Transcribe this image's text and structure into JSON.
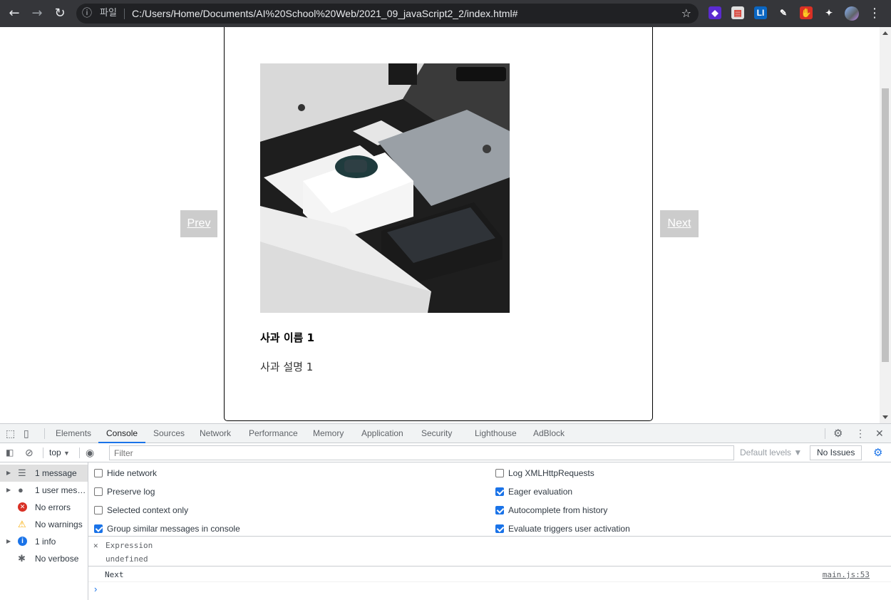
{
  "browser": {
    "back": "←",
    "forward": "→",
    "reload": "↻",
    "info_icon": "ⓘ",
    "protocol_label": "파일",
    "url": "C:/Users/Home/Documents/AI%20School%20Web/2021_09_javaScript2_2/index.html#",
    "bookmark_star": "☆",
    "extensions": [
      {
        "name": "purple-gem-extension",
        "color": "#5b2bd1",
        "glyph": "◆"
      },
      {
        "name": "red-note-extension",
        "color": "#e0e0e0",
        "glyph": "▤"
      },
      {
        "name": "li-extension",
        "color": "#0a66c2",
        "glyph": "LI"
      },
      {
        "name": "pen-extension",
        "color": "#35363a",
        "glyph": "✎"
      },
      {
        "name": "adblock-extension",
        "color": "#d93025",
        "glyph": "✋"
      },
      {
        "name": "puzzle-extension",
        "color": "#35363a",
        "glyph": "✦"
      }
    ],
    "menu": "⋮"
  },
  "slider": {
    "prev_label": "Prev",
    "next_label": "Next",
    "item_title": "사과 이름 1",
    "item_description": "사과 설명 1"
  },
  "devtools": {
    "tabs": [
      {
        "label": "Elements",
        "active": false
      },
      {
        "label": "Console",
        "active": true
      },
      {
        "label": "Sources",
        "active": false
      },
      {
        "label": "Network",
        "active": false
      },
      {
        "label": "Performance",
        "active": false
      },
      {
        "label": "Memory",
        "active": false
      },
      {
        "label": "Application",
        "active": false
      },
      {
        "label": "Security",
        "active": false
      },
      {
        "label": "Lighthouse",
        "active": false
      },
      {
        "label": "AdBlock",
        "active": false
      }
    ],
    "context": "top",
    "filter_placeholder": "Filter",
    "default_levels": "Default levels ▼",
    "issues_button": "No Issues",
    "sidebar": [
      {
        "label": "1 message",
        "icon": "☰",
        "icon_color": "#5f6368",
        "expandable": true,
        "selected": true
      },
      {
        "label": "1 user mess...",
        "icon": "●",
        "icon_color": "#5f6368",
        "expandable": true,
        "selected": false
      },
      {
        "label": "No errors",
        "icon": "✕",
        "icon_color": "#d93025",
        "expandable": false,
        "selected": false
      },
      {
        "label": "No warnings",
        "icon": "⚠",
        "icon_color": "#f9ab00",
        "expandable": false,
        "selected": false
      },
      {
        "label": "1 info",
        "icon": "i",
        "icon_color": "#1a73e8",
        "expandable": true,
        "selected": false
      },
      {
        "label": "No verbose",
        "icon": "✱",
        "icon_color": "#5f6368",
        "expandable": false,
        "selected": false
      }
    ],
    "settings_left": [
      {
        "label": "Hide network",
        "checked": false
      },
      {
        "label": "Preserve log",
        "checked": false
      },
      {
        "label": "Selected context only",
        "checked": false
      },
      {
        "label": "Group similar messages in console",
        "checked": true
      }
    ],
    "settings_right": [
      {
        "label": "Log XMLHttpRequests",
        "checked": false
      },
      {
        "label": "Eager evaluation",
        "checked": true
      },
      {
        "label": "Autocomplete from history",
        "checked": true
      },
      {
        "label": "Evaluate triggers user activation",
        "checked": true
      }
    ],
    "expression_label": "Expression",
    "expression_value": "undefined",
    "log_message": "Next",
    "log_source": "main.js:53",
    "prompt": "›"
  }
}
